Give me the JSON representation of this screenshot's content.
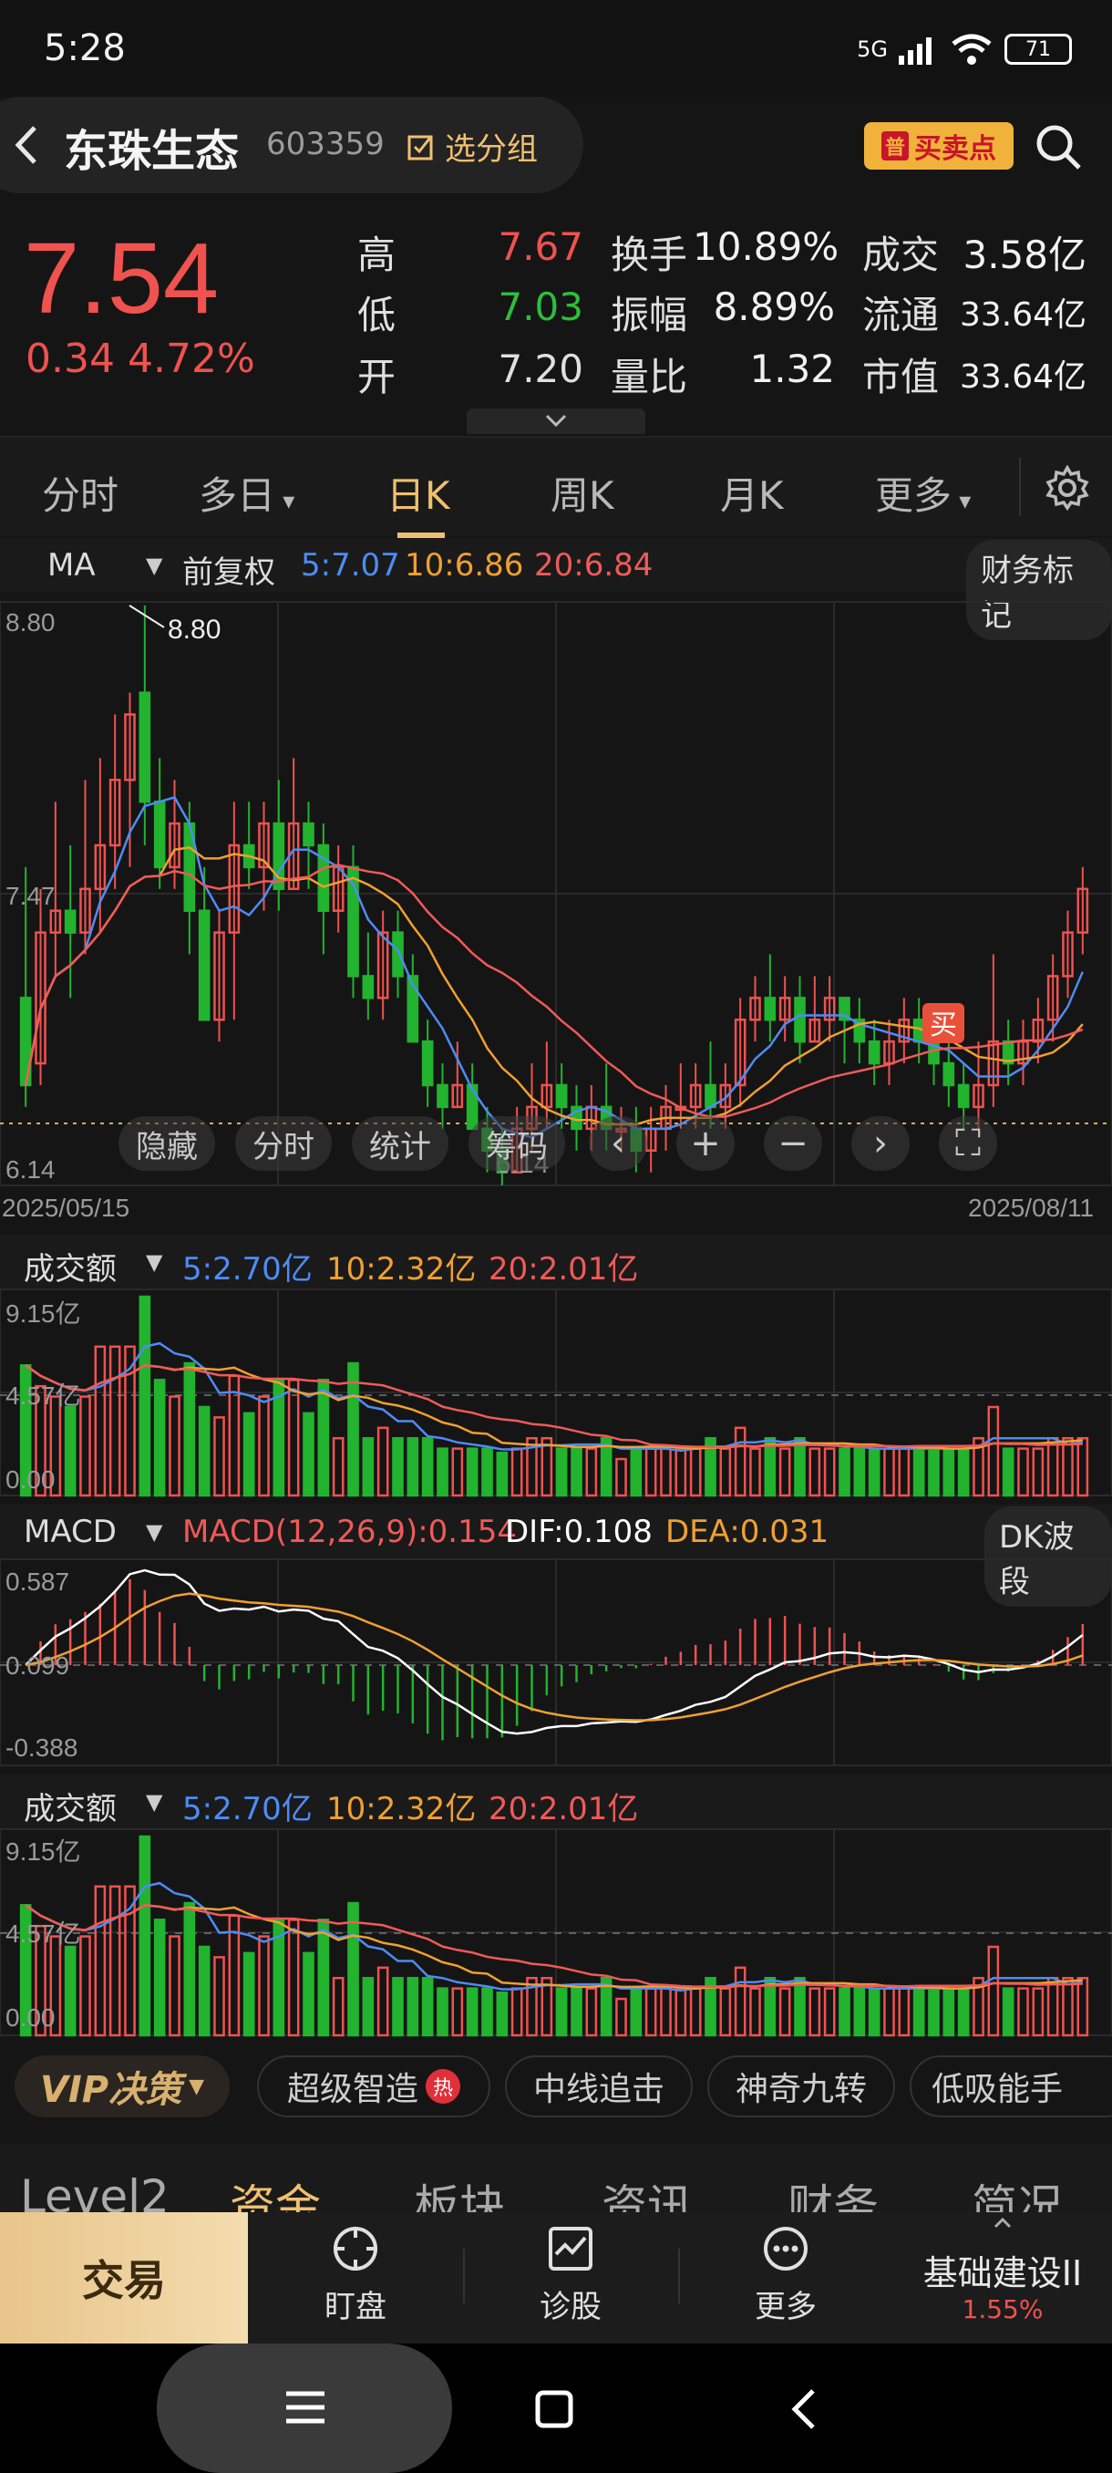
{
  "status": {
    "time": "5:28",
    "network": "5G",
    "battery": "71"
  },
  "header": {
    "stock_name": "东珠生态",
    "stock_code": "603359",
    "group_label": "选分组",
    "buy_sell_label": "买卖点",
    "buy_sell_tag": "普"
  },
  "quote": {
    "price": "7.54",
    "change": "0.34",
    "change_pct": "4.72%",
    "stats": [
      {
        "label": "高",
        "value": "7.67",
        "color": "#f0524f"
      },
      {
        "label": "低",
        "value": "7.03",
        "color": "#2cbf3a"
      },
      {
        "label": "开",
        "value": "7.20",
        "color": "#e0e0e0"
      }
    ],
    "stats2": [
      {
        "label": "换手",
        "value": "10.89%"
      },
      {
        "label": "振幅",
        "value": "8.89%"
      },
      {
        "label": "量比",
        "value": "1.32"
      }
    ],
    "stats3": [
      {
        "label": "成交",
        "value": "3.58亿"
      },
      {
        "label": "流通",
        "value": "33.64亿"
      },
      {
        "label": "市值",
        "value": "33.64亿"
      }
    ]
  },
  "tabs": {
    "items": [
      "分时",
      "多日",
      "日K",
      "周K",
      "月K",
      "更多"
    ],
    "active": 2
  },
  "kline": {
    "indicator": "MA",
    "adjust": "前复权",
    "ma5": "5:7.07",
    "ma10": "10:6.86",
    "ma20": "20:6.84",
    "finance_btn": "财务标记",
    "price_high": "8.80",
    "price_mid": "7.47",
    "price_low": "6.14",
    "marker_high": "8.80",
    "marker_low": "6.14",
    "date_start": "2025/05/15",
    "date_end": "2025/08/11",
    "buy_marker": "买",
    "toolbar": [
      "隐藏",
      "分时",
      "统计",
      "筹码"
    ]
  },
  "volume1": {
    "name": "成交额",
    "ma5": "5:2.70亿",
    "ma10": "10:2.32亿",
    "ma20": "20:2.01亿",
    "top": "9.15亿",
    "mid": "4.57亿",
    "bottom": "0.00"
  },
  "macd": {
    "name": "MACD",
    "params": "MACD(12,26,9):0.154",
    "dif": "DIF:0.108",
    "dea": "DEA:0.031",
    "extra_btn": "DK波段",
    "top": "0.587",
    "mid": "0.099",
    "bottom": "-0.388"
  },
  "volume2": {
    "name": "成交额",
    "ma5": "5:2.70亿",
    "ma10": "10:2.32亿",
    "ma20": "20:2.01亿",
    "top": "9.15亿",
    "mid": "4.57亿",
    "bottom": "0.00"
  },
  "vip": {
    "label": "VIP决策",
    "chips": [
      "超级智造",
      "中线追击",
      "神奇九转",
      "低吸能手"
    ],
    "hot": "热"
  },
  "level2_tabs": {
    "items": [
      "Level2",
      "资金",
      "板块",
      "资讯",
      "财务",
      "简况"
    ],
    "active": 1
  },
  "bottom_nav": {
    "trade": "交易",
    "items": [
      "盯盘",
      "诊股",
      "更多"
    ],
    "sector": "基础建设II",
    "sector_change": "1.55%"
  },
  "chart_data": {
    "type": "candlestick",
    "x_start": "2025/05/15",
    "x_end": "2025/08/11",
    "ylim": [
      6.14,
      8.8
    ],
    "candles": [
      [
        7.0,
        6.6,
        7.6,
        6.5
      ],
      [
        6.7,
        7.3,
        7.5,
        6.6
      ],
      [
        7.3,
        7.4,
        7.9,
        7.1
      ],
      [
        7.4,
        7.3,
        7.7,
        7.0
      ],
      [
        7.3,
        7.5,
        8.0,
        7.2
      ],
      [
        7.5,
        7.7,
        8.1,
        7.3
      ],
      [
        7.7,
        8.0,
        8.3,
        7.5
      ],
      [
        8.0,
        8.3,
        8.4,
        7.6
      ],
      [
        8.4,
        7.9,
        8.8,
        7.7
      ],
      [
        7.9,
        7.6,
        8.1,
        7.5
      ],
      [
        7.6,
        7.8,
        8.0,
        7.5
      ],
      [
        7.8,
        7.4,
        7.9,
        7.2
      ],
      [
        7.4,
        6.9,
        7.6,
        6.9
      ],
      [
        6.9,
        7.3,
        7.4,
        6.8
      ],
      [
        7.3,
        7.7,
        7.9,
        6.9
      ],
      [
        7.7,
        7.6,
        7.9,
        7.5
      ],
      [
        7.6,
        7.8,
        7.9,
        7.4
      ],
      [
        7.8,
        7.5,
        8.0,
        7.4
      ],
      [
        7.5,
        7.8,
        8.1,
        7.5
      ],
      [
        7.8,
        7.7,
        7.9,
        7.5
      ],
      [
        7.7,
        7.4,
        7.8,
        7.2
      ],
      [
        7.4,
        7.6,
        7.7,
        7.3
      ],
      [
        7.6,
        7.1,
        7.7,
        7.0
      ],
      [
        7.1,
        7.0,
        7.3,
        6.9
      ],
      [
        7.0,
        7.3,
        7.4,
        6.9
      ],
      [
        7.3,
        7.1,
        7.4,
        7.0
      ],
      [
        7.1,
        6.8,
        7.2,
        6.8
      ],
      [
        6.8,
        6.6,
        6.9,
        6.5
      ],
      [
        6.6,
        6.5,
        6.7,
        6.4
      ],
      [
        6.5,
        6.6,
        6.8,
        6.5
      ],
      [
        6.6,
        6.4,
        6.7,
        6.4
      ],
      [
        6.4,
        6.3,
        6.5,
        6.2
      ],
      [
        6.3,
        6.2,
        6.4,
        6.14
      ],
      [
        6.2,
        6.4,
        6.5,
        6.2
      ],
      [
        6.4,
        6.5,
        6.7,
        6.3
      ],
      [
        6.5,
        6.6,
        6.8,
        6.4
      ],
      [
        6.6,
        6.5,
        6.7,
        6.4
      ],
      [
        6.5,
        6.4,
        6.6,
        6.3
      ],
      [
        6.4,
        6.5,
        6.6,
        6.3
      ],
      [
        6.5,
        6.4,
        6.7,
        6.3
      ],
      [
        6.4,
        6.4,
        6.5,
        6.3
      ],
      [
        6.4,
        6.3,
        6.5,
        6.2
      ],
      [
        6.3,
        6.4,
        6.5,
        6.2
      ],
      [
        6.4,
        6.5,
        6.6,
        6.3
      ],
      [
        6.5,
        6.5,
        6.7,
        6.4
      ],
      [
        6.5,
        6.6,
        6.7,
        6.4
      ],
      [
        6.6,
        6.5,
        6.8,
        6.4
      ],
      [
        6.5,
        6.6,
        6.7,
        6.4
      ],
      [
        6.6,
        6.9,
        7.0,
        6.5
      ],
      [
        6.9,
        7.0,
        7.1,
        6.8
      ],
      [
        7.0,
        6.9,
        7.2,
        6.8
      ],
      [
        6.9,
        7.0,
        7.1,
        6.8
      ],
      [
        7.0,
        6.8,
        7.1,
        6.7
      ],
      [
        6.8,
        6.9,
        7.1,
        6.8
      ],
      [
        6.9,
        7.0,
        7.1,
        6.8
      ],
      [
        7.0,
        6.9,
        7.0,
        6.7
      ],
      [
        6.9,
        6.8,
        7.0,
        6.7
      ],
      [
        6.8,
        6.7,
        6.9,
        6.6
      ],
      [
        6.7,
        6.8,
        6.9,
        6.6
      ],
      [
        6.8,
        6.9,
        7.0,
        6.7
      ],
      [
        6.9,
        6.8,
        7.0,
        6.7
      ],
      [
        6.8,
        6.7,
        6.9,
        6.6
      ],
      [
        6.7,
        6.6,
        6.8,
        6.5
      ],
      [
        6.6,
        6.5,
        6.7,
        6.4
      ],
      [
        6.5,
        6.6,
        6.8,
        6.4
      ],
      [
        6.6,
        6.8,
        7.2,
        6.5
      ],
      [
        6.8,
        6.7,
        6.9,
        6.6
      ],
      [
        6.7,
        6.8,
        6.9,
        6.6
      ],
      [
        6.8,
        6.9,
        7.0,
        6.7
      ],
      [
        6.9,
        7.1,
        7.2,
        6.8
      ],
      [
        7.1,
        7.3,
        7.4,
        7.0
      ],
      [
        7.3,
        7.5,
        7.6,
        7.2
      ]
    ]
  }
}
